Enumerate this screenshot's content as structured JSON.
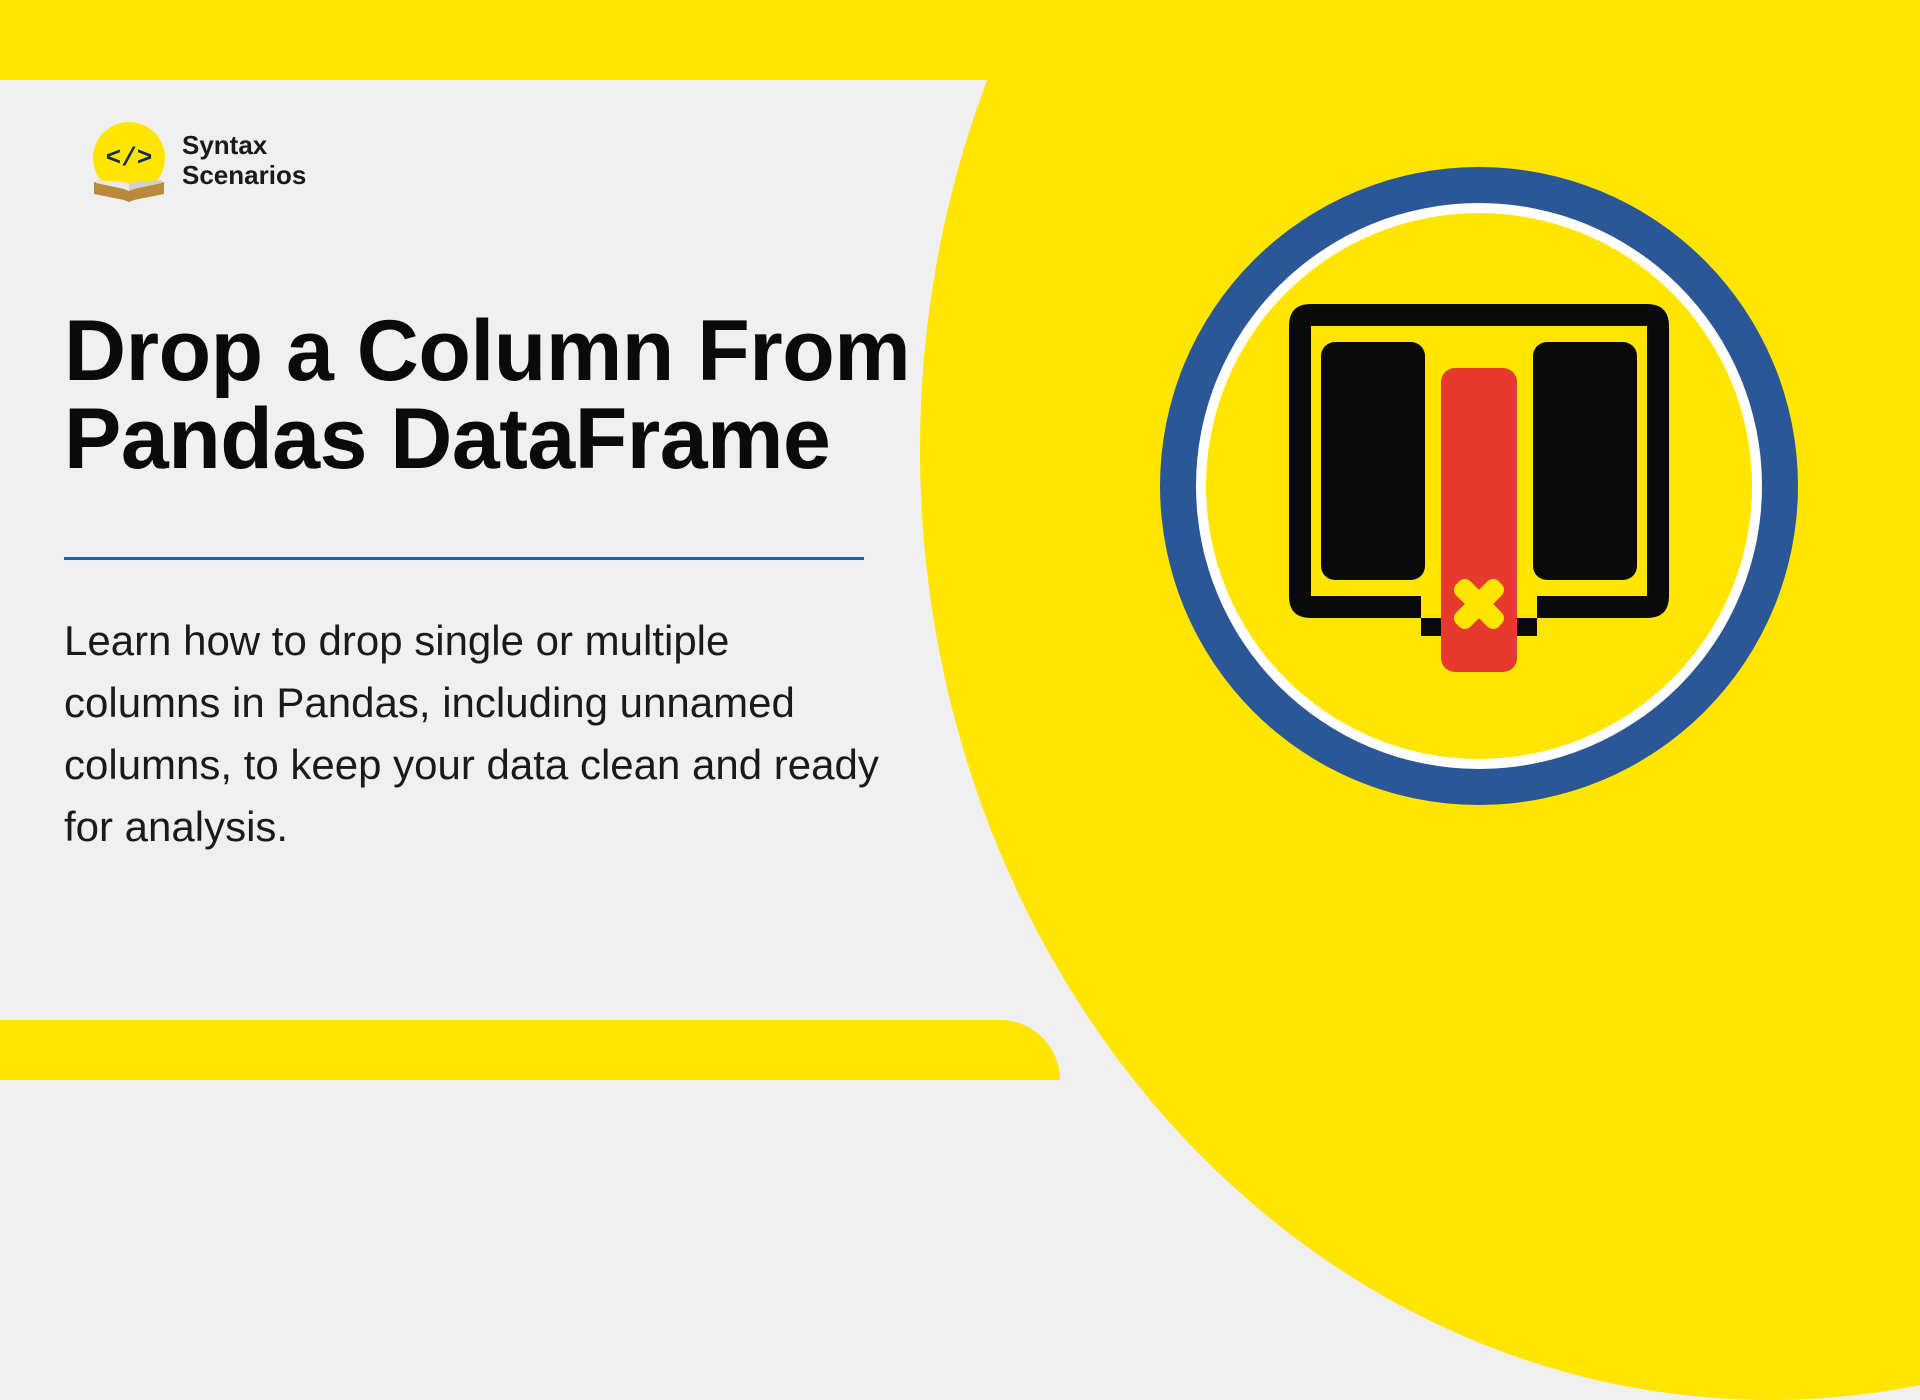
{
  "brand": {
    "name_line1": "Syntax",
    "name_line2": "Scenarios"
  },
  "hero": {
    "title_line1": "Drop a Column From",
    "title_line2": "Pandas DataFrame",
    "description": "Learn how to drop single or multiple columns in Pandas, including unnamed columns, to keep your data clean and ready for analysis."
  },
  "colors": {
    "accent": "#ffe500",
    "ring": "#2b5797",
    "danger": "#e63a2e",
    "dark": "#0a0a0a"
  }
}
